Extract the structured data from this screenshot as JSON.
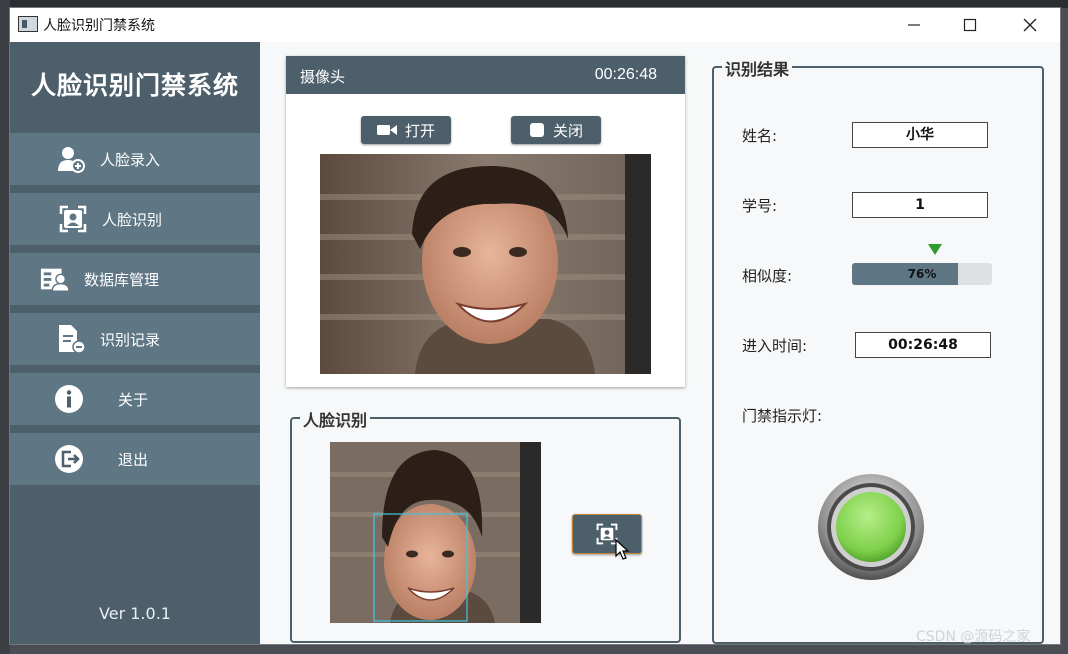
{
  "window": {
    "title": "人脸识别门禁系统",
    "controls": [
      "minimize",
      "maximize",
      "close"
    ]
  },
  "sidebar": {
    "app_name": "人脸识别门禁系统",
    "items": [
      {
        "label": "人脸录入",
        "icon": "add-user-icon"
      },
      {
        "label": "人脸识别",
        "icon": "face-scan-icon"
      },
      {
        "label": "数据库管理",
        "icon": "database-card-icon"
      },
      {
        "label": "识别记录",
        "icon": "record-document-icon"
      },
      {
        "label": "关于",
        "icon": "info-icon"
      },
      {
        "label": "退出",
        "icon": "logout-icon"
      }
    ],
    "version": "Ver 1.0.1"
  },
  "camera": {
    "title": "摄像头",
    "time": "00:26:48",
    "open_label": "打开",
    "close_label": "关闭"
  },
  "recognition": {
    "title": "人脸识别",
    "scan_button_icon": "face-scan-icon"
  },
  "result": {
    "title": "识别结果",
    "name_label": "姓名:",
    "name_value": "小华",
    "id_label": "学号:",
    "id_value": "1",
    "similarity_label": "相似度:",
    "similarity_text": "76%",
    "similarity_value": 0.76,
    "time_label": "进入时间:",
    "time_value": "00:26:48",
    "light_label": "门禁指示灯:"
  },
  "colors": {
    "sidebar": "#4d5f6b",
    "nav_item": "#5f7785",
    "indicator": "#7ed04a",
    "marker": "#2e9b2e"
  },
  "watermark": "CSDN @源码之家"
}
